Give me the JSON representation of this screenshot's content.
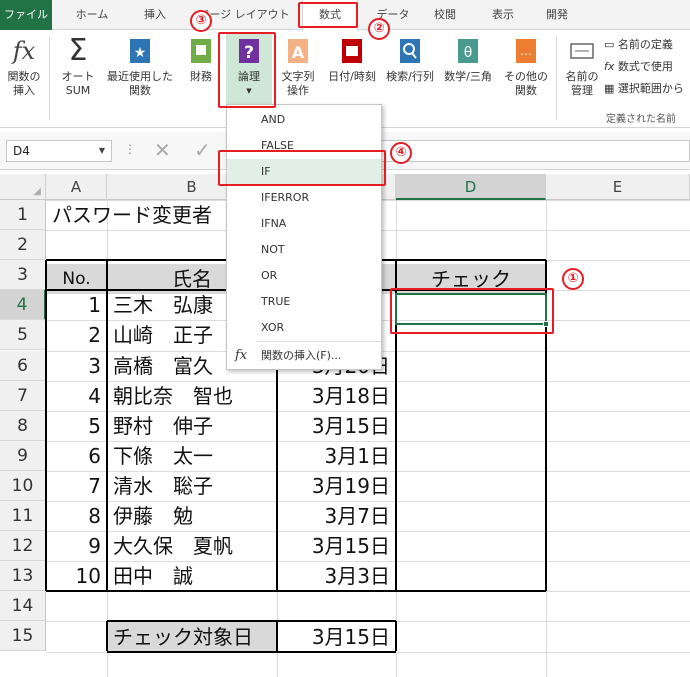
{
  "tabs": [
    "ファイル",
    "ホーム",
    "挿入",
    "ページ レイアウト",
    "数式",
    "データ",
    "校閲",
    "表示",
    "開発"
  ],
  "ribbon": {
    "insert_function": "関数の\n挿入",
    "autosum": "オート\nSUM",
    "recent": "最近使用した\n関数",
    "financial": "財務",
    "logical": "論理",
    "text": "文字列\n操作",
    "datetime": "日付/時刻",
    "lookup": "検索/行列",
    "math": "数学/三角",
    "more": "その他の\n関数",
    "name_manager": "名前の\n管理",
    "define_name": "名前の定義",
    "use_in_formula": "数式で使用",
    "create_from_selection": "選択範囲から",
    "defined_names_group": "定義された名前"
  },
  "formula_bar": {
    "name_box": "D4"
  },
  "columns": [
    "A",
    "B",
    "C",
    "D",
    "E"
  ],
  "rows": [
    "1",
    "2",
    "3",
    "4",
    "5",
    "6",
    "7",
    "8",
    "9",
    "10",
    "11",
    "12",
    "13",
    "14",
    "15"
  ],
  "sheet": {
    "title": "パスワード変更者",
    "header_no": "No.",
    "header_name": "氏名",
    "header_check": "チェック",
    "records": [
      {
        "no": "1",
        "name": "三木　弘康",
        "date": ""
      },
      {
        "no": "2",
        "name": "山崎　正子",
        "date": ""
      },
      {
        "no": "3",
        "name": "高橋　富久",
        "date": "3月20日"
      },
      {
        "no": "4",
        "name": "朝比奈　智也",
        "date": "3月18日"
      },
      {
        "no": "5",
        "name": "野村　伸子",
        "date": "3月15日"
      },
      {
        "no": "6",
        "name": "下條　太一",
        "date": "3月1日"
      },
      {
        "no": "7",
        "name": "清水　聡子",
        "date": "3月19日"
      },
      {
        "no": "8",
        "name": "伊藤　勉",
        "date": "3月7日"
      },
      {
        "no": "9",
        "name": "大久保　夏帆",
        "date": "3月15日"
      },
      {
        "no": "10",
        "name": "田中　誠",
        "date": "3月3日"
      }
    ],
    "target_label": "チェック対象日",
    "target_value": "3月15日"
  },
  "dropdown": {
    "items": [
      "AND",
      "FALSE",
      "IF",
      "IFERROR",
      "IFNA",
      "NOT",
      "OR",
      "TRUE",
      "XOR"
    ],
    "insert_function": "関数の挿入(F)..."
  },
  "callouts": [
    "①",
    "②",
    "③",
    "④"
  ],
  "colors": {
    "excel_green": "#217346",
    "callout_red": "#e51d24"
  }
}
